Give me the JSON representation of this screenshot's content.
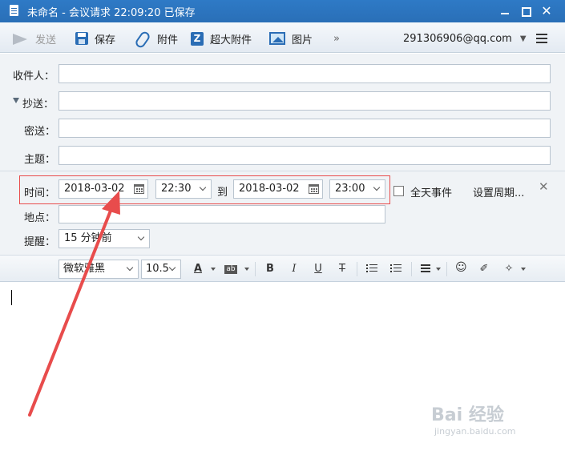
{
  "window": {
    "title": "未命名 - 会议请求    22:09:20 已保存",
    "close_glyph": "✕"
  },
  "toolbar": {
    "send_label": "发送",
    "save_label": "保存",
    "attach_label": "附件",
    "big_attach_label": "超大附件",
    "big_attach_icon_letter": "Z",
    "picture_label": "图片",
    "more_label": "»",
    "account": "291306906@qq.com"
  },
  "header": {
    "to_label": "收件人：",
    "cc_label": "抄送：",
    "bcc_label": "密送：",
    "subject_label": "主题：",
    "to_value": "",
    "cc_value": "",
    "bcc_value": "",
    "subject_value": ""
  },
  "meeting": {
    "time_label": "时间：",
    "start_date": "2018-03-02",
    "start_time": "22:30",
    "to_text": "到",
    "end_date": "2018-03-02",
    "end_time": "23:00",
    "all_day_label": "全天事件",
    "all_day_checked": false,
    "recurrence_label": "设置周期...",
    "location_label": "地点：",
    "location_value": "",
    "reminder_label": "提醒：",
    "reminder_value": "15 分钟前"
  },
  "format": {
    "font_family": "微软雅黑",
    "font_size": "10.5",
    "font_color_glyph": "A",
    "highlight_glyph": "ab",
    "bold_glyph": "B",
    "italic_glyph": "I",
    "underline_glyph": "U",
    "strike_glyph": "T",
    "emoji_glyph": "☺",
    "clear_glyph": "✐",
    "magic_glyph": "✧"
  },
  "watermark": {
    "main": "Bai 经验",
    "sub": "jingyan.baidu.com"
  },
  "colors": {
    "titlebar": "#2a6fb7",
    "annotation": "#e84c4c"
  }
}
